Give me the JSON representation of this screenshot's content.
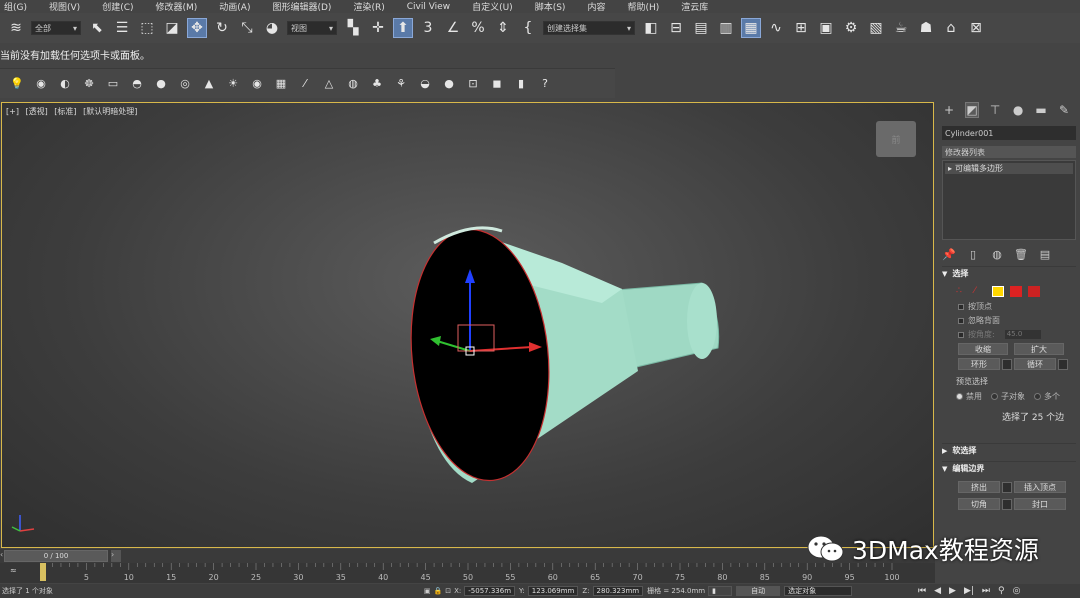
{
  "menu": {
    "items": [
      "组(G)",
      "视图(V)",
      "创建(C)",
      "修改器(M)",
      "动画(A)",
      "图形编辑器(D)",
      "渲染(R)",
      "Civil View",
      "自定义(U)",
      "脚本(S)",
      "内容",
      "帮助(H)",
      "渲云库"
    ]
  },
  "toolbar": {
    "filter_label": "全部",
    "refcoord_label": "视图",
    "selection_set_label": "创建选择集"
  },
  "notice": {
    "text": "当前没有加载任何选项卡或面板。"
  },
  "viewport": {
    "labels": [
      "[+]",
      "[透视]",
      "[标准]",
      "[默认明暗处理]"
    ],
    "viewcube_label": "前"
  },
  "command_panel": {
    "object_name": "Cylinder001",
    "modifier_list_label": "修改器列表",
    "modifier_stack": [
      "可编辑多边形"
    ],
    "selection": {
      "title": "选择",
      "by_vertex": "按顶点",
      "ignore_backfacing": "忽略背面",
      "by_angle": "按角度:",
      "angle_value": "45.0",
      "shrink": "收缩",
      "grow": "扩大",
      "ring": "环形",
      "loop": "循环",
      "preview_title": "预览选择",
      "preview_off": "禁用",
      "preview_subobject": "子对象",
      "preview_multi": "多个",
      "selected_count": "选择了 25 个边"
    },
    "soft_selection_title": "软选择",
    "edit_borders": {
      "title": "编辑边界",
      "extrude": "挤出",
      "insert_vertex": "插入顶点",
      "chamfer": "切角",
      "cap": "封口"
    }
  },
  "timeline": {
    "frame_label": "0 / 100",
    "ticks": [
      5,
      10,
      15,
      20,
      25,
      30,
      35,
      40,
      45,
      50,
      55,
      60,
      65,
      70,
      75,
      80,
      85,
      90,
      95,
      100
    ]
  },
  "status": {
    "selected": "选择了 1 个对象",
    "x_label": "X:",
    "x_value": "-5057.336m",
    "y_label": "Y:",
    "y_value": "123.069mm",
    "z_label": "Z:",
    "z_value": "280.323mm",
    "grid": "栅格 = 254.0mm",
    "auto": "自动",
    "selected_object": "选定对象"
  },
  "watermark": {
    "text": "3DMax教程资源"
  },
  "colors": {
    "viewport_border": "#d8b84a",
    "object_fill": "#a8e0cc",
    "active_blue": "#5a7aa8"
  }
}
